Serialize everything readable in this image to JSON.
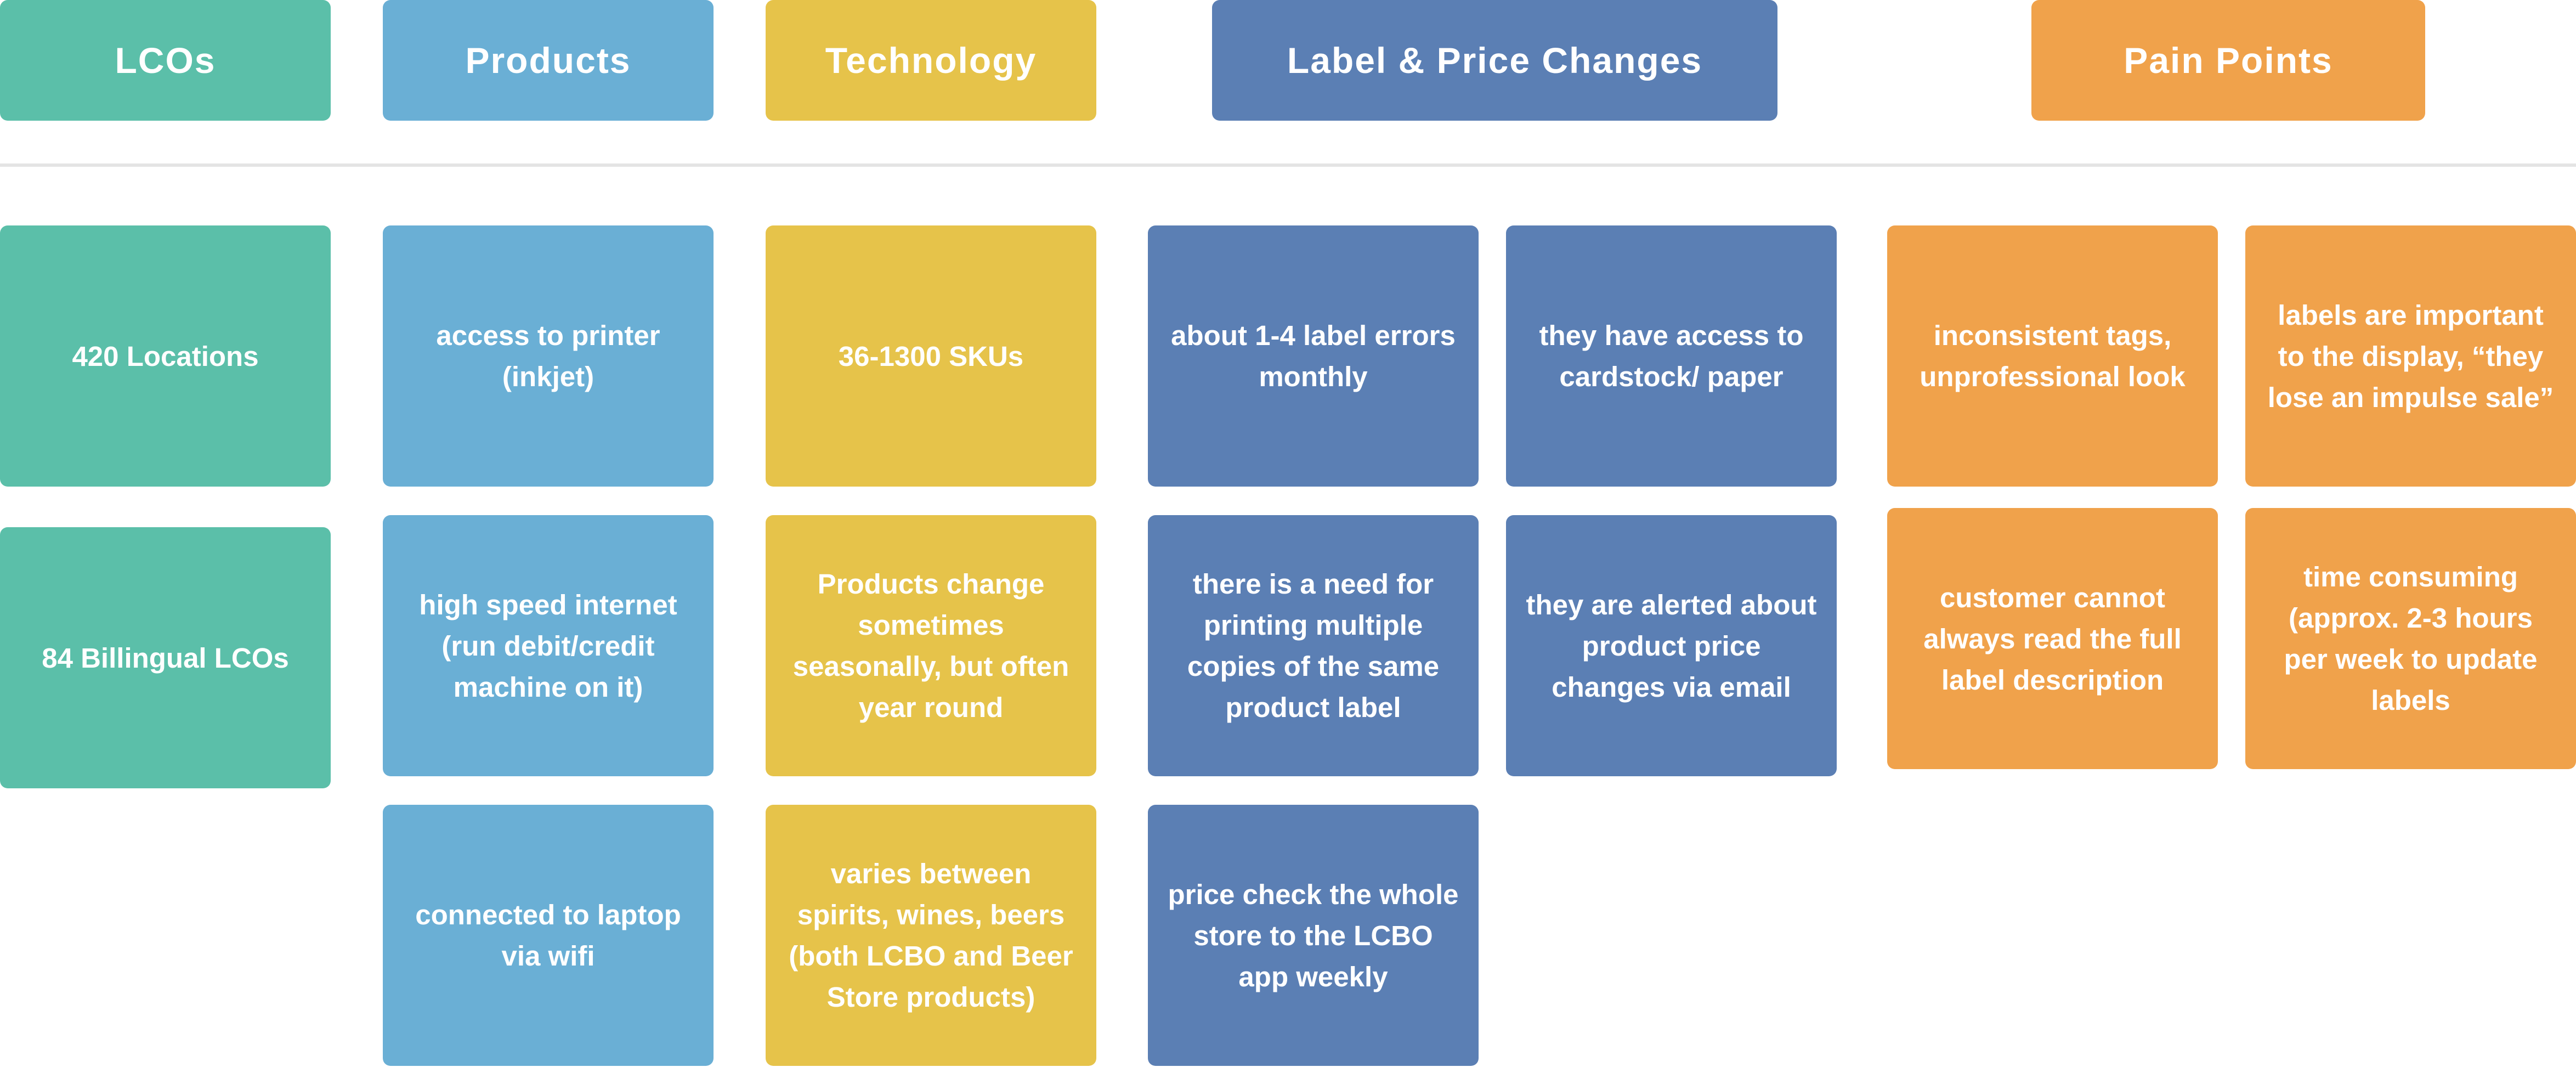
{
  "headers": {
    "lcos": "LCOs",
    "products": "Products",
    "technology": "Technology",
    "label_price_changes": "Label & Price Changes",
    "pain_points": "Pain Points"
  },
  "lcos": [
    "420 Locations",
    "84 Billingual LCOs"
  ],
  "products": [
    "access to printer (inkjet)",
    "high speed internet (run debit/credit machine on it)",
    "connected to laptop via wifi"
  ],
  "technology": [
    "36-1300 SKUs",
    "Products change sometimes seasonally, but often year round",
    "varies between spirits, wines, beers (both LCBO and Beer Store products)"
  ],
  "label_price_changes": {
    "col1": [
      "about 1-4 label errors monthly",
      "there is a need for printing multiple copies of the same product label",
      "price check the whole store to the LCBO app weekly"
    ],
    "col2": [
      "they have access to cardstock/ paper",
      "they are alerted about product price changes via email"
    ]
  },
  "pain_points": {
    "col1": [
      "inconsistent tags, unprofessional look",
      "customer cannot always read the full label description"
    ],
    "col2": [
      "labels are important to the display, “they lose an impulse sale”",
      "time consuming (approx. 2-3 hours per week to update labels"
    ]
  },
  "colors": {
    "lcos": "#5bbfa9",
    "products": "#6aafd5",
    "technology": "#e6c34a",
    "label_price_changes": "#5b7fb4",
    "pain_points": "#f0a24b"
  }
}
